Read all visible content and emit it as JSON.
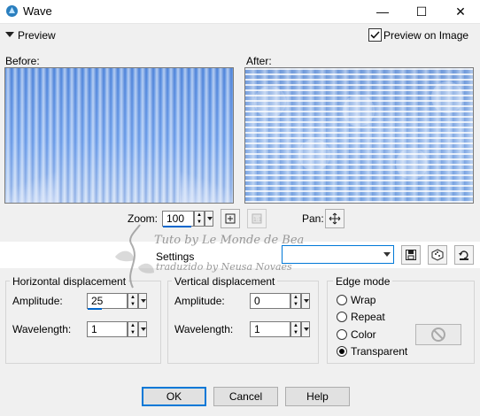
{
  "window": {
    "title": "Wave",
    "minimize_glyph": "—",
    "maximize_glyph": "☐",
    "close_glyph": "✕",
    "app_icon": "paint-shop-icon"
  },
  "preview": {
    "toggle_label": "Preview",
    "preview_on_image_label": "Preview on Image",
    "preview_on_image_checked": true,
    "before_label": "Before:",
    "after_label": "After:"
  },
  "zoom": {
    "label": "Zoom:",
    "value": "100",
    "pan_label": "Pan:",
    "icons": [
      "zoom-fit-icon",
      "actual-size-icon",
      "pan-move-icon"
    ]
  },
  "settings": {
    "label": "Settings",
    "selected": "",
    "icons": [
      "save-preset-icon",
      "randomize-icon",
      "reset-icon"
    ]
  },
  "horizontal": {
    "title": "Horizontal displacement",
    "amplitude_label": "Amplitude:",
    "amplitude_value": "25",
    "wavelength_label": "Wavelength:",
    "wavelength_value": "1"
  },
  "vertical": {
    "title": "Vertical displacement",
    "amplitude_label": "Amplitude:",
    "amplitude_value": "0",
    "wavelength_label": "Wavelength:",
    "wavelength_value": "1"
  },
  "edge_mode": {
    "title": "Edge mode",
    "options": [
      "Wrap",
      "Repeat",
      "Color",
      "Transparent"
    ],
    "selected": "Transparent"
  },
  "buttons": {
    "ok": "OK",
    "cancel": "Cancel",
    "help": "Help"
  },
  "watermark": {
    "line1": "Tuto by Le Monde de Bea",
    "line2": "traduzido by Neusa Novaes"
  },
  "colors": {
    "accent": "#0078d7",
    "window_bg": "#f0f0f0"
  }
}
